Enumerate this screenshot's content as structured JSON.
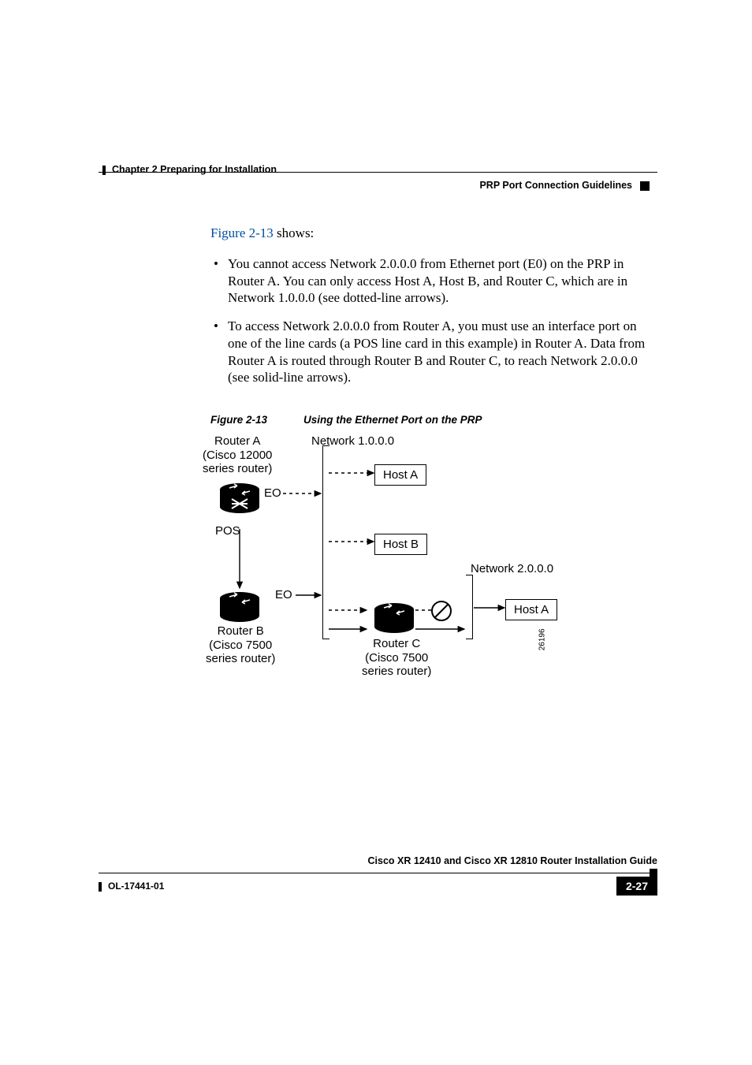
{
  "header": {
    "chapter": "Chapter 2    Preparing for Installation",
    "section": "PRP Port Connection Guidelines"
  },
  "intro": {
    "link": "Figure 2-13",
    "rest": " shows:"
  },
  "bullets": [
    "You cannot access Network 2.0.0.0 from Ethernet port (E0) on the PRP in Router A. You can only access Host A, Host B, and Router C, which are in Network 1.0.0.0 (see dotted-line arrows).",
    "To access Network 2.0.0.0 from Router A, you must use an interface port on one of the line cards (a POS line card in this example) in Router A. Data from Router A is routed through Router B and Router C, to reach Network 2.0.0.0 (see solid-line arrows)."
  ],
  "figure": {
    "label": "Figure 2-13",
    "caption": "Using the Ethernet Port on the PRP",
    "id": "26196",
    "labels": {
      "routerA": "Router A",
      "routerA_sub1": "(Cisco 12000",
      "routerA_sub2": "series router)",
      "routerB": "Router B",
      "routerB_sub1": "(Cisco 7500",
      "routerB_sub2": "series router)",
      "routerC": "Router C",
      "routerC_sub1": "(Cisco 7500",
      "routerC_sub2": "series router)",
      "net1": "Network 1.0.0.0",
      "net2": "Network 2.0.0.0",
      "hostA": "Host A",
      "hostB": "Host B",
      "hostA2": "Host A",
      "eo1": "EO",
      "eo2": "EO",
      "pos": "POS"
    }
  },
  "footer": {
    "guide": "Cisco XR 12410 and Cisco XR 12810 Router Installation Guide",
    "ol": "OL-17441-01",
    "page": "2-27"
  }
}
